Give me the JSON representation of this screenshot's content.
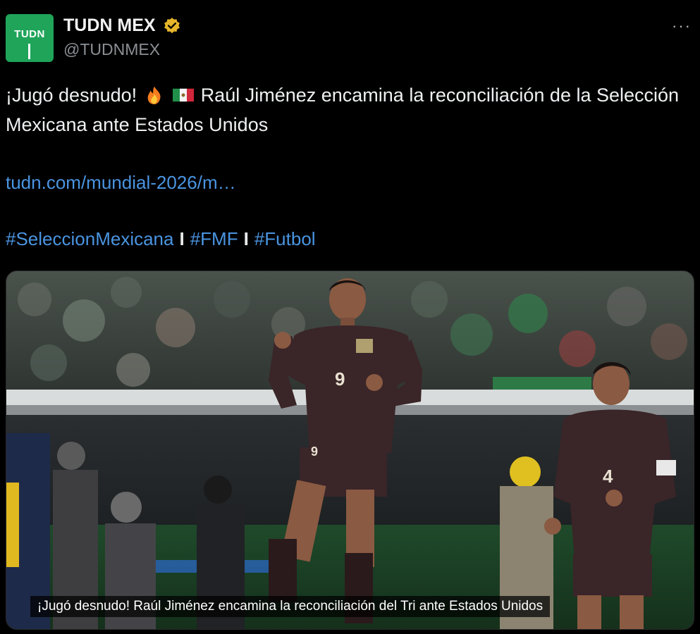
{
  "account": {
    "display_name": "TUDN MEX",
    "handle": "@TUDNMEX",
    "avatar_text": "TUDN",
    "verified_color": "#e6b52a",
    "brand_color": "#1fa45a"
  },
  "menu": {
    "more_label": "···"
  },
  "tweet": {
    "text_part1": "¡Jugó desnudo!",
    "emoji1": "fire-icon",
    "emoji2": "mexico-flag-icon",
    "text_part2": "Raúl Jiménez encamina la reconciliación de la Selección Mexicana ante Estados Unidos",
    "link": "tudn.com/mundial-2026/m…",
    "hashtags": [
      "#SeleccionMexicana",
      "#FMF",
      "#Futbol"
    ],
    "hashtag_separator": "I"
  },
  "media": {
    "player1_number": "9",
    "player2_number": "4",
    "caption": "¡Jugó desnudo! Raúl Jiménez encamina la reconciliación del Tri ante Estados Unidos"
  },
  "colors": {
    "link": "#4a94e0",
    "background": "#000000",
    "jersey": "#3a2528"
  }
}
